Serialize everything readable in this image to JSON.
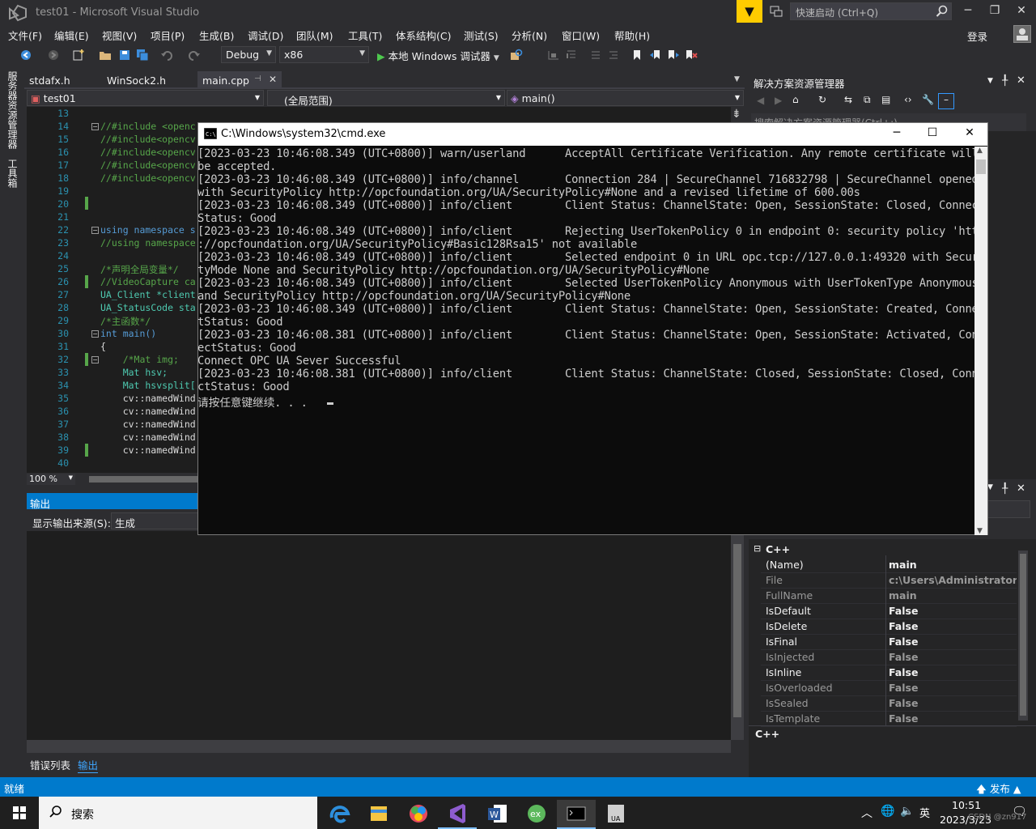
{
  "window": {
    "title": "test01 - Microsoft Visual Studio",
    "quick_launch_placeholder": "快速启动 (Ctrl+Q)",
    "login": "登录"
  },
  "menu": [
    "文件(F)",
    "编辑(E)",
    "视图(V)",
    "项目(P)",
    "生成(B)",
    "调试(D)",
    "团队(M)",
    "工具(T)",
    "体系结构(C)",
    "测试(S)",
    "分析(N)",
    "窗口(W)",
    "帮助(H)"
  ],
  "toolbar": {
    "config": "Debug",
    "platform": "x86",
    "start_label": "本地 Windows 调试器"
  },
  "left_strip": {
    "server_explorer": "服务器资源管理器",
    "toolbox": "工具箱"
  },
  "editor": {
    "tabs": [
      "stdafx.h",
      "WinSock2.h",
      "main.cpp"
    ],
    "active_tab": "main.cpp",
    "project_scope": "test01",
    "global_scope": "(全局范围)",
    "member_scope": "main()",
    "zoom": "100 %",
    "line_numbers": [
      "13",
      "14",
      "15",
      "16",
      "17",
      "18",
      "19",
      "20",
      "21",
      "22",
      "23",
      "24",
      "25",
      "26",
      "27",
      "28",
      "29",
      "30",
      "31",
      "32",
      "33",
      "34",
      "35",
      "36",
      "37",
      "38",
      "39",
      "40"
    ],
    "code_lines": [
      "",
      "//#include <openc",
      "//#include<opencv",
      "//#include<opencv",
      "//#include<opencv",
      "//#include<opencv",
      "",
      "",
      "",
      "using namespace s",
      "//using namespace",
      "",
      "/*声明全局变量*/",
      "//VideoCapture ca",
      "UA_Client *client",
      "UA_StatusCode sta",
      "/*主函数*/",
      "int main()",
      "{",
      "    /*Mat img;",
      "    Mat hsv;",
      "    Mat hsvsplit[",
      "    cv::namedWind",
      "    cv::namedWind",
      "    cv::namedWind",
      "    cv::namedWind",
      "    cv::namedWind",
      ""
    ]
  },
  "output": {
    "title": "输出",
    "source_label": "显示输出来源(S):",
    "source_value": "生成",
    "bottom_tabs": [
      "错误列表",
      "输出"
    ]
  },
  "solution_explorer": {
    "title": "解决方案资源管理器",
    "search_placeholder": "搜索解决方案资源管理器(Ctrl+;)"
  },
  "properties": {
    "category": "C++",
    "rows": [
      {
        "name": "(Name)",
        "value": "main",
        "dim": false
      },
      {
        "name": "File",
        "value": "c:\\Users\\Administrator.DE",
        "dim": true
      },
      {
        "name": "FullName",
        "value": "main",
        "dim": true
      },
      {
        "name": "IsDefault",
        "value": "False",
        "dim": false
      },
      {
        "name": "IsDelete",
        "value": "False",
        "dim": false
      },
      {
        "name": "IsFinal",
        "value": "False",
        "dim": false
      },
      {
        "name": "IsInjected",
        "value": "False",
        "dim": true
      },
      {
        "name": "IsInline",
        "value": "False",
        "dim": false
      },
      {
        "name": "IsOverloaded",
        "value": "False",
        "dim": true
      },
      {
        "name": "IsSealed",
        "value": "False",
        "dim": true
      },
      {
        "name": "IsTemplate",
        "value": "False",
        "dim": true
      }
    ],
    "description": "C++"
  },
  "status": {
    "text": "就绪",
    "publish": "发布"
  },
  "taskbar": {
    "search": "搜索",
    "time": "10:51",
    "date": "2023/3/23",
    "ime": "英",
    "watermark": "CSDN @zn917"
  },
  "cmd": {
    "title": "C:\\Windows\\system32\\cmd.exe",
    "lines": [
      "[2023-03-23 10:46:08.349 (UTC+0800)] warn/userland      AcceptAll Certificate Verification. Any remote certificate will",
      "be accepted.",
      "[2023-03-23 10:46:08.349 (UTC+0800)] info/channel       Connection 284 | SecureChannel 716832798 | SecureChannel opened",
      "with SecurityPolicy http://opcfoundation.org/UA/SecurityPolicy#None and a revised lifetime of 600.00s",
      "[2023-03-23 10:46:08.349 (UTC+0800)] info/client        Client Status: ChannelState: Open, SessionState: Closed, Connect",
      "Status: Good",
      "[2023-03-23 10:46:08.349 (UTC+0800)] info/client        Rejecting UserTokenPolicy 0 in endpoint 0: security policy 'http",
      "://opcfoundation.org/UA/SecurityPolicy#Basic128Rsa15' not available",
      "[2023-03-23 10:46:08.349 (UTC+0800)] info/client        Selected endpoint 0 in URL opc.tcp://127.0.0.1:49320 with Securi",
      "tyMode None and SecurityPolicy http://opcfoundation.org/UA/SecurityPolicy#None",
      "[2023-03-23 10:46:08.349 (UTC+0800)] info/client        Selected UserTokenPolicy Anonymous with UserTokenType Anonymous",
      "and SecurityPolicy http://opcfoundation.org/UA/SecurityPolicy#None",
      "[2023-03-23 10:46:08.349 (UTC+0800)] info/client        Client Status: ChannelState: Open, SessionState: Created, Connec",
      "tStatus: Good",
      "[2023-03-23 10:46:08.381 (UTC+0800)] info/client        Client Status: ChannelState: Open, SessionState: Activated, Conn",
      "ectStatus: Good",
      "Connect OPC UA Sever Successful",
      "[2023-03-23 10:46:08.381 (UTC+0800)] info/client        Client Status: ChannelState: Closed, SessionState: Closed, Conne",
      "ctStatus: Good",
      "请按任意键继续. . ."
    ]
  }
}
